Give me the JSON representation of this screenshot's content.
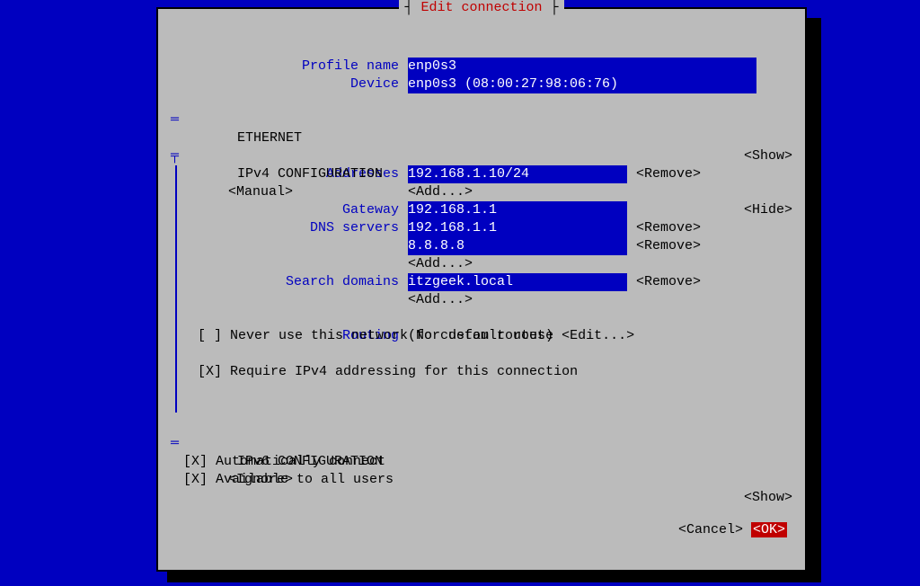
{
  "title": "Edit connection",
  "labels": {
    "profile_name": "Profile name",
    "device": "Device",
    "ethernet": "ETHERNET",
    "ipv4": "IPv4 CONFIGURATION",
    "addresses": "Addresses",
    "gateway": "Gateway",
    "dns": "DNS servers",
    "search_domains": "Search domains",
    "routing": "Routing",
    "ipv6": "IPv6 CONFIGURATION"
  },
  "values": {
    "profile_name": "enp0s3",
    "device": "enp0s3 (08:00:27:98:06:76)",
    "ipv4_mode": "<Manual>",
    "address1": "192.168.1.10/24",
    "gateway": "192.168.1.1",
    "dns1": "192.168.1.1",
    "dns2": "8.8.8.8",
    "search1": "itzgeek.local",
    "routing_status": "(No custom routes)",
    "ipv6_mode": "<Ignore>"
  },
  "buttons": {
    "show": "<Show>",
    "hide": "<Hide>",
    "remove": "<Remove>",
    "add": "<Add...>",
    "edit": "<Edit...>",
    "cancel": "<Cancel>",
    "ok": "<OK>"
  },
  "checkboxes": {
    "never_default": "[ ] Never use this network for default route",
    "require_ipv4": "[X] Require IPv4 addressing for this connection",
    "auto_connect": "[X] Automatically connect",
    "all_users": "[X] Available to all users"
  }
}
